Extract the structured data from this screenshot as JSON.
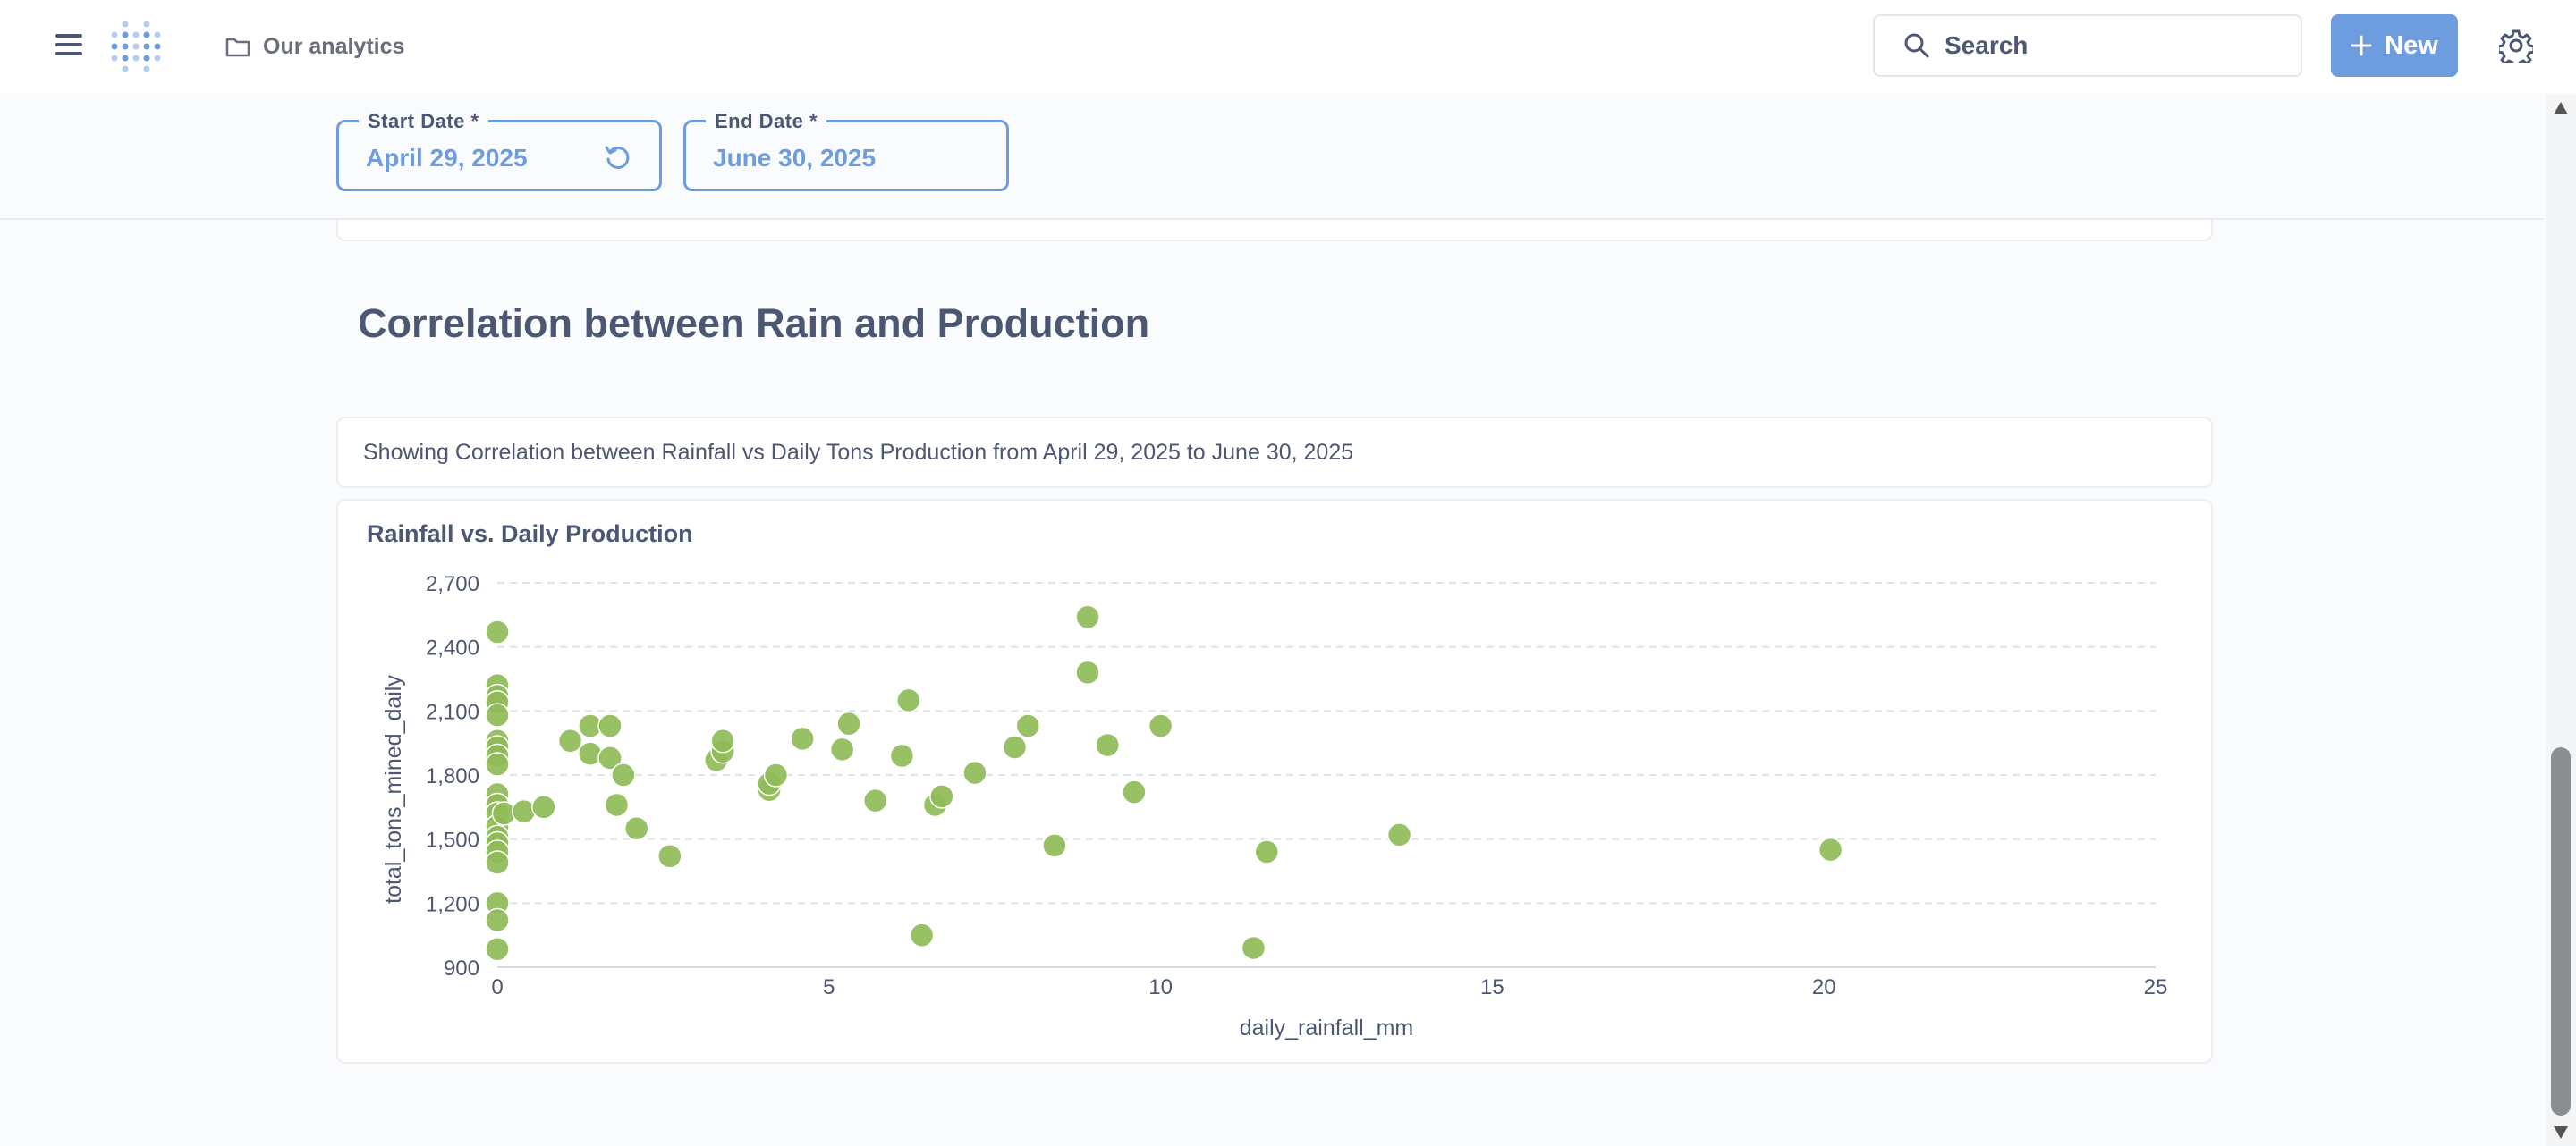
{
  "header": {
    "breadcrumb": "Our analytics",
    "search_placeholder": "Search",
    "new_label": "New"
  },
  "filters": {
    "start_date": {
      "label": "Start Date *",
      "value": "April 29, 2025"
    },
    "end_date": {
      "label": "End Date *",
      "value": "June 30, 2025"
    }
  },
  "section": {
    "heading": "Correlation between Rain and Production",
    "text": "Showing Correlation between Rainfall vs Daily Tons Production from April 29, 2025 to June 30, 2025"
  },
  "colors": {
    "accent": "#6d9cdf",
    "point": "#8fbb57",
    "text": "#4c5773"
  },
  "chart_data": {
    "type": "scatter",
    "title": "Rainfall vs. Daily Production",
    "xlabel": "daily_rainfall_mm",
    "ylabel": "total_tons_mined_daily",
    "xlim": [
      0,
      25
    ],
    "ylim": [
      900,
      2700
    ],
    "x_ticks": [
      "0",
      "5",
      "10",
      "15",
      "20",
      "25"
    ],
    "y_ticks": [
      "900",
      "1,200",
      "1,500",
      "1,800",
      "2,100",
      "2,400",
      "2,700"
    ],
    "grid": true,
    "series": [
      {
        "points": [
          [
            0,
            2470
          ],
          [
            0,
            2220
          ],
          [
            0,
            2170
          ],
          [
            0,
            2140
          ],
          [
            0,
            2080
          ],
          [
            0,
            1960
          ],
          [
            0,
            1930
          ],
          [
            0,
            1890
          ],
          [
            0,
            1850
          ],
          [
            0,
            1710
          ],
          [
            0,
            1660
          ],
          [
            0,
            1620
          ],
          [
            0,
            1560
          ],
          [
            0,
            1510
          ],
          [
            0,
            1480
          ],
          [
            0,
            1440
          ],
          [
            0,
            1390
          ],
          [
            0,
            1200
          ],
          [
            0,
            1120
          ],
          [
            0,
            985
          ],
          [
            0.1,
            1620
          ],
          [
            0.4,
            1630
          ],
          [
            0.7,
            1650
          ],
          [
            1.1,
            1960
          ],
          [
            1.4,
            2030
          ],
          [
            1.4,
            1900
          ],
          [
            1.7,
            2030
          ],
          [
            1.7,
            1880
          ],
          [
            1.8,
            1660
          ],
          [
            1.9,
            1800
          ],
          [
            2.1,
            1550
          ],
          [
            2.6,
            1420
          ],
          [
            3.3,
            1870
          ],
          [
            3.4,
            1910
          ],
          [
            3.4,
            1960
          ],
          [
            4.1,
            1730
          ],
          [
            4.1,
            1760
          ],
          [
            4.2,
            1800
          ],
          [
            4.6,
            1970
          ],
          [
            5.2,
            1920
          ],
          [
            5.3,
            2040
          ],
          [
            5.7,
            1680
          ],
          [
            6.1,
            1890
          ],
          [
            6.2,
            2150
          ],
          [
            6.4,
            1050
          ],
          [
            6.6,
            1660
          ],
          [
            6.7,
            1700
          ],
          [
            7.2,
            1810
          ],
          [
            7.8,
            1930
          ],
          [
            8.0,
            2030
          ],
          [
            8.4,
            1470
          ],
          [
            8.9,
            2540
          ],
          [
            8.9,
            2280
          ],
          [
            9.2,
            1940
          ],
          [
            9.6,
            1720
          ],
          [
            10.0,
            2030
          ],
          [
            11.4,
            990
          ],
          [
            11.6,
            1440
          ],
          [
            13.6,
            1520
          ],
          [
            20.1,
            1450
          ]
        ]
      }
    ]
  }
}
